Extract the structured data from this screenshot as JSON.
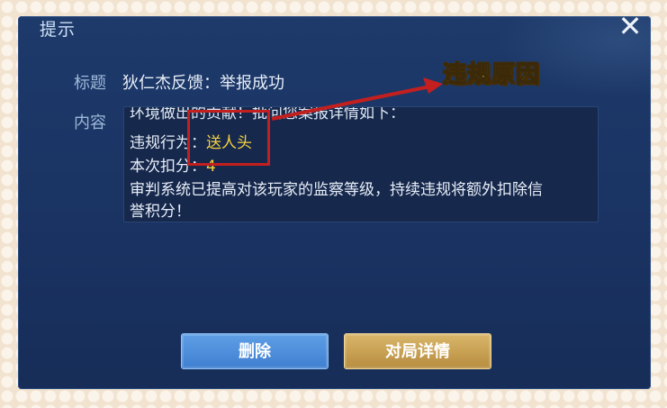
{
  "dialog": {
    "title": "提示",
    "close_icon": "close-icon",
    "subject_label": "标题",
    "subject": "狄仁杰反馈：举报成功",
    "content_label": "内容",
    "content": {
      "partial_line": "环境做出的贡献！批问您案报详情如下：",
      "violation_label": "违规行为：",
      "violation_value": "送人头",
      "deduction_label": "本次扣分：",
      "deduction_value": "4",
      "notice_line1": "审判系统已提高对该玩家的监察等级，持续违规将额外扣除信",
      "notice_line2": "誉积分！"
    },
    "buttons": {
      "delete": "删除",
      "details": "对局详情"
    }
  },
  "annotation": {
    "text": "违规原因",
    "color": "#f7d93c",
    "arrow_color": "#c41f1f"
  }
}
